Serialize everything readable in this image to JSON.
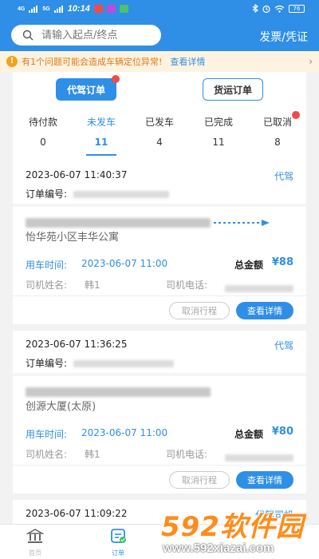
{
  "status_bar": {
    "signal1": "4G",
    "signal2": "5G",
    "time": "10:14",
    "battery": "76"
  },
  "header": {
    "search_placeholder": "请输入起点/终点",
    "invoice_link": "发票/凭证"
  },
  "notice": {
    "text": "有1个问题可能会造成车辆定位异常!",
    "detail_link": "查看详情"
  },
  "order_types": [
    {
      "label": "代驾订单"
    },
    {
      "label": "货运订单"
    }
  ],
  "tabs": [
    {
      "label": "待付款",
      "count": "0"
    },
    {
      "label": "未发车",
      "count": "11"
    },
    {
      "label": "已发车",
      "count": "4"
    },
    {
      "label": "已完成",
      "count": "11"
    },
    {
      "label": "已取消",
      "count": "8"
    }
  ],
  "orders": [
    {
      "time": "2023-06-07 11:40:37",
      "tag": "代驾",
      "order_no_label": "订单编号:",
      "destination": "怡华苑小区丰华公寓",
      "use_time_label": "用车时间:",
      "use_time": "2023-06-07 11:00",
      "total_label": "总金额",
      "total": "¥88",
      "driver_label": "司机姓名:",
      "driver": "韩1",
      "phone_label": "司机电话:",
      "cancel_label": "取消行程",
      "detail_label": "查看详情"
    },
    {
      "time": "2023-06-07 11:36:25",
      "tag": "代驾",
      "order_no_label": "订单编号:",
      "destination": "创源大厦(太原)",
      "use_time_label": "用车时间:",
      "use_time": "2023-06-07 11:00",
      "total_label": "总金额",
      "total": "¥80",
      "driver_label": "司机姓名:",
      "driver": "韩1",
      "phone_label": "司机电话:",
      "cancel_label": "取消行程",
      "detail_label": "查看详情"
    },
    {
      "time": "2023-06-07 11:09:22",
      "tag": "代驾司机"
    }
  ],
  "bottom_nav": [
    {
      "label": "首页"
    },
    {
      "label": "订单"
    }
  ],
  "watermark": {
    "main": "592软件园",
    "url": "www.592xiazai.com"
  },
  "colors": {
    "primary": "#2f8fe6",
    "notice_bg": "#fdf3e0",
    "notice_text": "#e07a1a",
    "badge": "#f04a4a",
    "watermark": "#ff8c1a"
  }
}
